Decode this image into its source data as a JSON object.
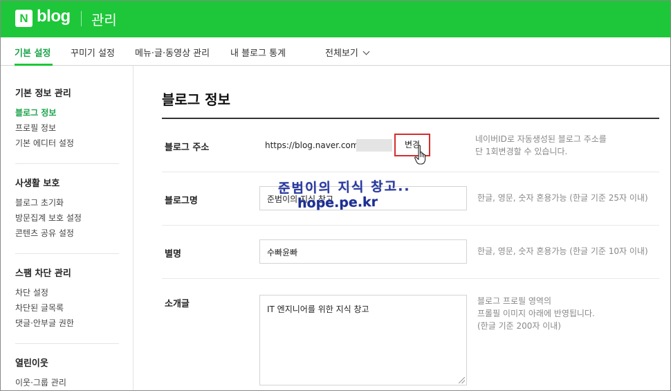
{
  "header": {
    "logo_letter": "N",
    "logo_text": "blog",
    "section_title": "관리"
  },
  "nav": {
    "tabs": [
      {
        "label": "기본 설정",
        "active": true
      },
      {
        "label": "꾸미기 설정",
        "active": false
      },
      {
        "label": "메뉴·글·동영상 관리",
        "active": false
      },
      {
        "label": "내 블로그 통계",
        "active": false
      },
      {
        "label": "전체보기",
        "active": false
      }
    ]
  },
  "sidebar": {
    "groups": [
      {
        "title": "기본 정보 관리",
        "items": [
          "블로그 정보",
          "프로필 정보",
          "기본 에디터 설정"
        ],
        "active_index": 0
      },
      {
        "title": "사생활 보호",
        "items": [
          "블로그 초기화",
          "방문집계 보호 설정",
          "콘텐츠 공유 설정"
        ]
      },
      {
        "title": "스팸 차단 관리",
        "items": [
          "차단 설정",
          "차단된 글목록",
          "댓글·안부글 권한"
        ]
      },
      {
        "title": "열린이웃",
        "items": [
          "이웃·그룹 관리"
        ]
      }
    ]
  },
  "main": {
    "page_title": "블로그 정보",
    "address": {
      "label": "블로그 주소",
      "url_prefix": "https://blog.naver.com/",
      "change_button": "변경",
      "help_line1": "네이버ID로 자동생성된 블로그 주소를",
      "help_line2": "단 1회변경할 수 있습니다."
    },
    "blog_name": {
      "label": "블로그명",
      "value": "준범이의 지식 창고",
      "help": "한글, 영문, 숫자 혼용가능 (한글 기준 25자 이내)"
    },
    "nickname": {
      "label": "별명",
      "value": "수빠윤빠",
      "help": "한글, 영문, 숫자 혼용가능 (한글 기준 10자 이내)"
    },
    "intro": {
      "label": "소개글",
      "value": "IT 엔지니어를 위한 지식 창고",
      "help_line1": "블로그 프로필 영역의",
      "help_line2": "프롤필 이미지 아래에 반영됩니다.",
      "help_line3": "(한글 기준 200자 이내)"
    },
    "watermark": {
      "line1": "준범이의 지식 창고..",
      "line2": "hope.pe.kr"
    }
  },
  "colors": {
    "brand_green": "#1dc739",
    "active_green": "#1aa34a",
    "highlight_red": "#d62b2b",
    "watermark_blue": "#2a3a9c"
  }
}
